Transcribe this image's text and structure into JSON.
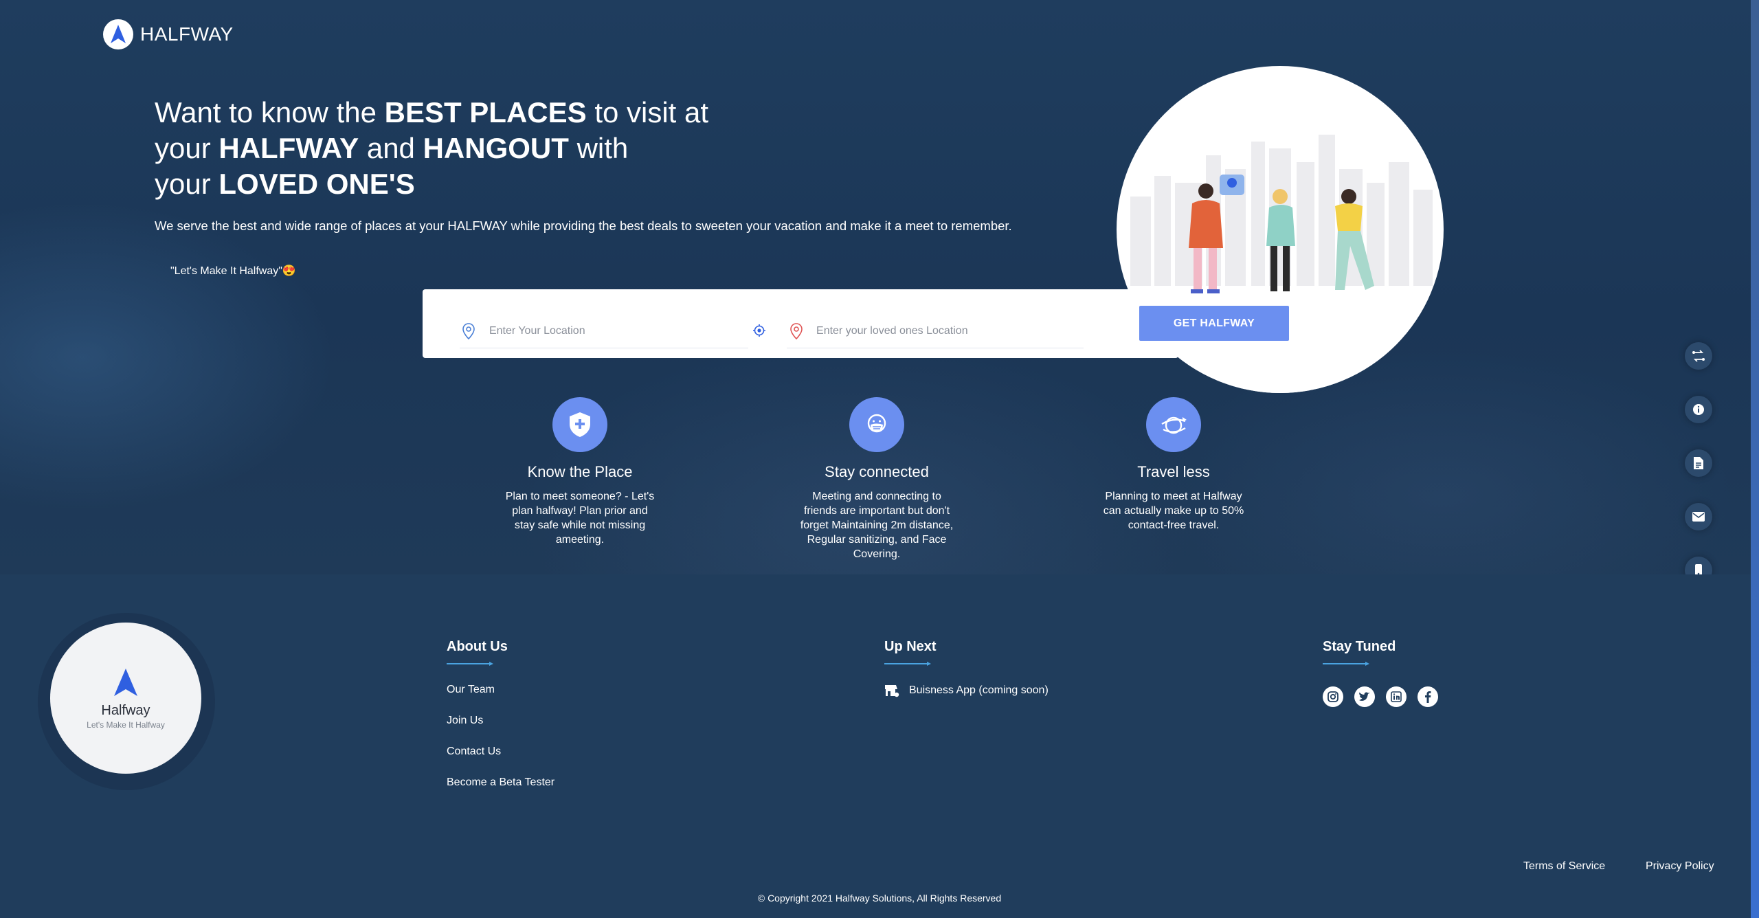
{
  "brand": {
    "name": "HALFWAY"
  },
  "hero": {
    "headline": [
      {
        "text": "Want to know the ",
        "bold": false
      },
      {
        "text": "BEST PLACES",
        "bold": true
      },
      {
        "text": " to visit at",
        "bold": false
      },
      {
        "text": "your ",
        "bold": false
      },
      {
        "text": "HALFWAY",
        "bold": true
      },
      {
        "text": " and ",
        "bold": false
      },
      {
        "text": "HANGOUT",
        "bold": true
      },
      {
        "text": " with",
        "bold": false
      },
      {
        "text": "your ",
        "bold": false
      },
      {
        "text": "LOVED ONE'S",
        "bold": true
      }
    ],
    "subline": "We serve the best and wide range of places at your HALFWAY while providing the best deals to sweeten your vacation and make it a meet to remember.",
    "tagline": "\"Let's Make It Halfway\"😍"
  },
  "search": {
    "your_location_placeholder": "Enter Your Location",
    "loved_location_placeholder": "Enter your loved ones Location",
    "button_label": "GET HALFWAY"
  },
  "features": [
    {
      "icon": "shield-plus-icon",
      "title": "Know the Place",
      "desc": "Plan to meet someone? - Let's plan halfway! Plan prior and stay safe while not missing ameeting."
    },
    {
      "icon": "face-mask-icon",
      "title": "Stay connected",
      "desc": "Meeting and connecting to friends are important but don't forget Maintaining 2m distance, Regular sanitizing, and Face Covering."
    },
    {
      "icon": "globe-travel-icon",
      "title": "Travel less",
      "desc": "Planning to meet at Halfway can actually make up to 50% contact-free travel."
    }
  ],
  "rail": [
    "route-icon",
    "info-icon",
    "document-icon",
    "mail-icon",
    "mobile-icon"
  ],
  "footer": {
    "logo_brand": "Halfway",
    "logo_sub": "Let's Make It Halfway",
    "about": {
      "title": "About Us",
      "links": [
        "Our Team",
        "Join Us",
        "Contact Us",
        "Become a Beta Tester"
      ]
    },
    "upnext": {
      "title": "Up Next",
      "item": "Buisness App (coming soon)"
    },
    "stay": {
      "title": "Stay Tuned",
      "socials": [
        "instagram-icon",
        "twitter-icon",
        "linkedin-icon",
        "facebook-icon"
      ]
    },
    "terms": "Terms of Service",
    "privacy": "Privacy Policy",
    "copyright": "© Copyright 2021 Halfway Solutions, All Rights Reserved"
  },
  "colors": {
    "accent": "#6b8ff0",
    "hero_bg": "#1f3d5e",
    "footer_bg": "#203d5c",
    "pin_red": "#e05555",
    "pin_blue": "#4a7fd6"
  }
}
